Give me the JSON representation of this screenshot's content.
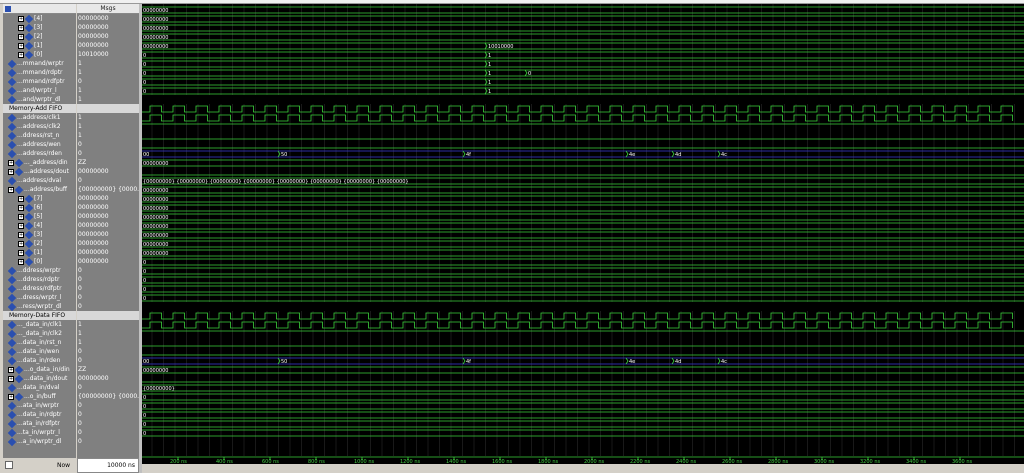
{
  "header": {
    "values_title": "Msgs"
  },
  "footer": {
    "now_label": "Now",
    "now_value": "10000 ns"
  },
  "timeline": {
    "unit": "ns",
    "ticks": [
      "200 ns",
      "400 ns",
      "600 ns",
      "800 ns",
      "1000 ns",
      "1200 ns",
      "1400 ns",
      "1600 ns",
      "1800 ns",
      "2000 ns",
      "2200 ns",
      "2400 ns",
      "2600 ns",
      "2800 ns",
      "3000 ns",
      "3200 ns",
      "3400 ns",
      "3600 ns"
    ]
  },
  "signals": [
    {
      "kind": "sub",
      "name": "[4]",
      "value": "00000000",
      "wave": "bus",
      "bus_labels": [
        "00000000"
      ]
    },
    {
      "kind": "sub",
      "name": "[3]",
      "value": "00000000",
      "wave": "bus",
      "bus_labels": [
        "00000000"
      ]
    },
    {
      "kind": "sub",
      "name": "[2]",
      "value": "00000000",
      "wave": "bus",
      "bus_labels": [
        "00000000"
      ]
    },
    {
      "kind": "sub",
      "name": "[1]",
      "value": "00000000",
      "wave": "bus",
      "bus_labels": [
        "00000000"
      ]
    },
    {
      "kind": "sub",
      "name": "[0]",
      "value": "10010000",
      "wave": "bus",
      "bus_labels": [
        "00000000",
        "10010000"
      ]
    },
    {
      "kind": "sig",
      "name": "...mmand/wrptr",
      "value": "1",
      "wave": "bus",
      "bus_labels": [
        "0",
        "1"
      ]
    },
    {
      "kind": "sig",
      "name": "...mmand/rdptr",
      "value": "1",
      "wave": "bus",
      "bus_labels": [
        "0",
        "1"
      ]
    },
    {
      "kind": "sig",
      "name": "...mmand/rdfptr",
      "value": "0",
      "wave": "bus",
      "bus_labels": [
        "0",
        "1",
        "0"
      ]
    },
    {
      "kind": "sig",
      "name": "...and/wrptr_l",
      "value": "1",
      "wave": "bus",
      "bus_labels": [
        "0",
        "1"
      ]
    },
    {
      "kind": "sig",
      "name": "...and/wrptr_dl",
      "value": "1",
      "wave": "bus",
      "bus_labels": [
        "0",
        "1"
      ]
    },
    {
      "kind": "group",
      "name": "Memory-Add FIFO"
    },
    {
      "kind": "sig",
      "name": "...address/clk1",
      "value": "1",
      "wave": "clk"
    },
    {
      "kind": "sig",
      "name": "...address/clk2",
      "value": "1",
      "wave": "clk"
    },
    {
      "kind": "sig",
      "name": "...ddress/rst_n",
      "value": "1",
      "wave": "high"
    },
    {
      "kind": "sig",
      "name": "...address/wen",
      "value": "0",
      "wave": "low"
    },
    {
      "kind": "sig",
      "name": "...address/rden",
      "value": "0",
      "wave": "low"
    },
    {
      "kind": "bus",
      "name": "..._address/din",
      "value": "ZZ",
      "wave": "bus",
      "bus_labels": [
        "00",
        "50",
        "4f",
        "4e",
        "4d",
        "4c"
      ],
      "bus_blue": true
    },
    {
      "kind": "bus",
      "name": "...address/dout",
      "value": "00000000",
      "wave": "bus",
      "bus_labels": [
        "00000000"
      ]
    },
    {
      "kind": "sig",
      "name": "...address/dval",
      "value": "0",
      "wave": "low"
    },
    {
      "kind": "bus",
      "name": "...address/buff",
      "value": "{00000000} {0000...",
      "wave": "bus",
      "bus_labels": [
        "{00000000} {00000000} {00000000} {00000000} {00000000} {00000000} {00000000} {00000000}"
      ]
    },
    {
      "kind": "sub",
      "name": "[7]",
      "value": "00000000",
      "wave": "bus",
      "bus_labels": [
        "00000000"
      ]
    },
    {
      "kind": "sub",
      "name": "[6]",
      "value": "00000000",
      "wave": "bus",
      "bus_labels": [
        "00000000"
      ]
    },
    {
      "kind": "sub",
      "name": "[5]",
      "value": "00000000",
      "wave": "bus",
      "bus_labels": [
        "00000000"
      ]
    },
    {
      "kind": "sub",
      "name": "[4]",
      "value": "00000000",
      "wave": "bus",
      "bus_labels": [
        "00000000"
      ]
    },
    {
      "kind": "sub",
      "name": "[3]",
      "value": "00000000",
      "wave": "bus",
      "bus_labels": [
        "00000000"
      ]
    },
    {
      "kind": "sub",
      "name": "[2]",
      "value": "00000000",
      "wave": "bus",
      "bus_labels": [
        "00000000"
      ]
    },
    {
      "kind": "sub",
      "name": "[1]",
      "value": "00000000",
      "wave": "bus",
      "bus_labels": [
        "00000000"
      ]
    },
    {
      "kind": "sub",
      "name": "[0]",
      "value": "00000000",
      "wave": "bus",
      "bus_labels": [
        "00000000"
      ]
    },
    {
      "kind": "sig",
      "name": "...ddress/wrptr",
      "value": "0",
      "wave": "bus",
      "bus_labels": [
        "0"
      ]
    },
    {
      "kind": "sig",
      "name": "...ddress/rdptr",
      "value": "0",
      "wave": "bus",
      "bus_labels": [
        "0"
      ]
    },
    {
      "kind": "sig",
      "name": "...ddress/rdfptr",
      "value": "0",
      "wave": "bus",
      "bus_labels": [
        "0"
      ]
    },
    {
      "kind": "sig",
      "name": "...dress/wrptr_l",
      "value": "0",
      "wave": "bus",
      "bus_labels": [
        "0"
      ]
    },
    {
      "kind": "sig",
      "name": "...ress/wrptr_dl",
      "value": "0",
      "wave": "bus",
      "bus_labels": [
        "0"
      ]
    },
    {
      "kind": "group",
      "name": "Memory-Data FIFO"
    },
    {
      "kind": "sig",
      "name": "..._data_in/clk1",
      "value": "1",
      "wave": "clk"
    },
    {
      "kind": "sig",
      "name": "..._data_in/clk2",
      "value": "1",
      "wave": "clk"
    },
    {
      "kind": "sig",
      "name": "...data_in/rst_n",
      "value": "1",
      "wave": "high"
    },
    {
      "kind": "sig",
      "name": "...data_in/wen",
      "value": "0",
      "wave": "low"
    },
    {
      "kind": "sig",
      "name": "...data_in/rden",
      "value": "0",
      "wave": "low"
    },
    {
      "kind": "bus",
      "name": "...o_data_in/din",
      "value": "ZZ",
      "wave": "bus",
      "bus_labels": [
        "00",
        "50",
        "4f",
        "4e",
        "4d",
        "4c"
      ],
      "bus_blue": true
    },
    {
      "kind": "bus",
      "name": "...data_in/dout",
      "value": "00000000",
      "wave": "bus",
      "bus_labels": [
        "00000000"
      ]
    },
    {
      "kind": "sig",
      "name": "...data_in/dval",
      "value": "0",
      "wave": "low"
    },
    {
      "kind": "bus",
      "name": "...o_in/buff",
      "value": "{00000000} {0000...",
      "wave": "bus",
      "bus_labels": [
        "{00000000}"
      ]
    },
    {
      "kind": "sig",
      "name": "...ata_in/wrptr",
      "value": "0",
      "wave": "bus",
      "bus_labels": [
        "0"
      ]
    },
    {
      "kind": "sig",
      "name": "...data_in/rdptr",
      "value": "0",
      "wave": "bus",
      "bus_labels": [
        "0"
      ]
    },
    {
      "kind": "sig",
      "name": "...ata_in/rdfptr",
      "value": "0",
      "wave": "bus",
      "bus_labels": [
        "0"
      ]
    },
    {
      "kind": "sig",
      "name": "...ta_in/wrptr_l",
      "value": "0",
      "wave": "bus",
      "bus_labels": [
        "0"
      ]
    },
    {
      "kind": "sig",
      "name": "...a_in/wrptr_dl",
      "value": "0",
      "wave": "bus",
      "bus_labels": [
        "0"
      ]
    }
  ]
}
